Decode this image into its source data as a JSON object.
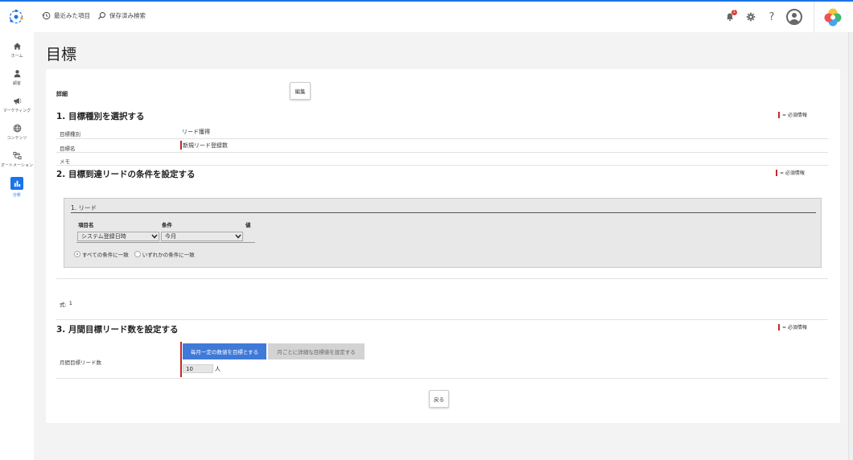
{
  "topbar": {
    "recent_label": "最近みた項目",
    "saved_search_label": "保存済み検索",
    "notification_count": "1",
    "help_label": "?"
  },
  "sidebar": {
    "items": [
      {
        "label": "ホーム",
        "icon": "home-icon"
      },
      {
        "label": "顧客",
        "icon": "person-icon"
      },
      {
        "label": "マーケティング",
        "icon": "megaphone-icon"
      },
      {
        "label": "コンテンツ",
        "icon": "globe-icon"
      },
      {
        "label": "オートメーション",
        "icon": "automation-icon"
      },
      {
        "label": "分析",
        "icon": "bar-chart-icon",
        "active": true
      }
    ]
  },
  "page": {
    "title": "目標"
  },
  "detail": {
    "label": "詳細",
    "edit_button": "編集",
    "required_note": "= 必須情報"
  },
  "section1": {
    "title": "1. 目標種別を選択する",
    "rows": [
      {
        "label": "目標種別",
        "value": "リード獲得"
      },
      {
        "label": "目標名",
        "value": "新規リード登録数"
      },
      {
        "label": "メモ",
        "value": ""
      }
    ]
  },
  "section2": {
    "title": "2. 目標到達リードの条件を設定する",
    "condition_title": "1. リード",
    "col_field": "項目名",
    "col_condition": "条件",
    "col_value": "値",
    "field_select": "システム登録日時",
    "condition_select": "今月",
    "radio_all": "すべての条件に一致",
    "radio_any": "いずれかの条件に一致",
    "formula_label": "式:",
    "formula_value": "1"
  },
  "section3": {
    "title": "3. 月間目標リード数を設定する",
    "row_label": "月間目標リード数",
    "seg_fixed": "毎月一定の数値を目標とする",
    "seg_monthly": "月ごとに詳細な目標値を設定する",
    "target_value": "10",
    "unit": "人"
  },
  "footer": {
    "back_button": "戻る"
  },
  "colors": {
    "accent": "#1a73e8",
    "required": "#c62828",
    "segment_active": "#3f7ad8"
  }
}
